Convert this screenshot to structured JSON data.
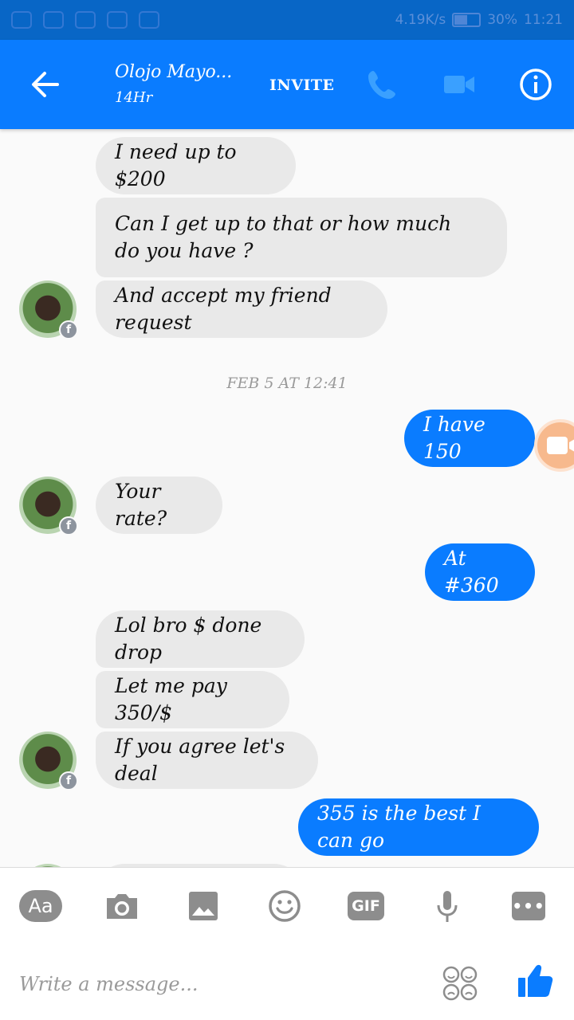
{
  "status_bar": {
    "speed": "4.19K/s",
    "battery": "30%",
    "time": "11:21"
  },
  "header": {
    "contact_name": "Olojo Mayo...",
    "contact_status": "14Hr",
    "invite_label": "INVITE"
  },
  "thread": {
    "timestamp": "FEB 5 AT 12:41",
    "messages": [
      {
        "from": "them",
        "text": "I need up to  $200"
      },
      {
        "from": "them",
        "text": "Can I get up to that or how much do you have ?"
      },
      {
        "from": "them",
        "text": "And accept my friend request"
      },
      {
        "from": "me",
        "text": "I have 150"
      },
      {
        "from": "them",
        "text": "Your rate?"
      },
      {
        "from": "me",
        "text": "At #360"
      },
      {
        "from": "them",
        "text": "Lol bro $ done drop"
      },
      {
        "from": "them",
        "text": "Let me pay 350/$"
      },
      {
        "from": "them",
        "text": "If you agree let's deal"
      },
      {
        "from": "me",
        "text": "355 is the best I can go"
      }
    ],
    "avatar_badge": "f"
  },
  "composer": {
    "aa_label": "Aa",
    "gif_label": "GIF",
    "more_label": "•••",
    "placeholder": "Write a message..."
  },
  "colors": {
    "header": "#0a7cff",
    "status_bar": "#0866c6",
    "incoming_bubble": "#e9e9e9",
    "outgoing_bubble": "#0a7cff",
    "icon_gray": "#8d8d8d"
  }
}
